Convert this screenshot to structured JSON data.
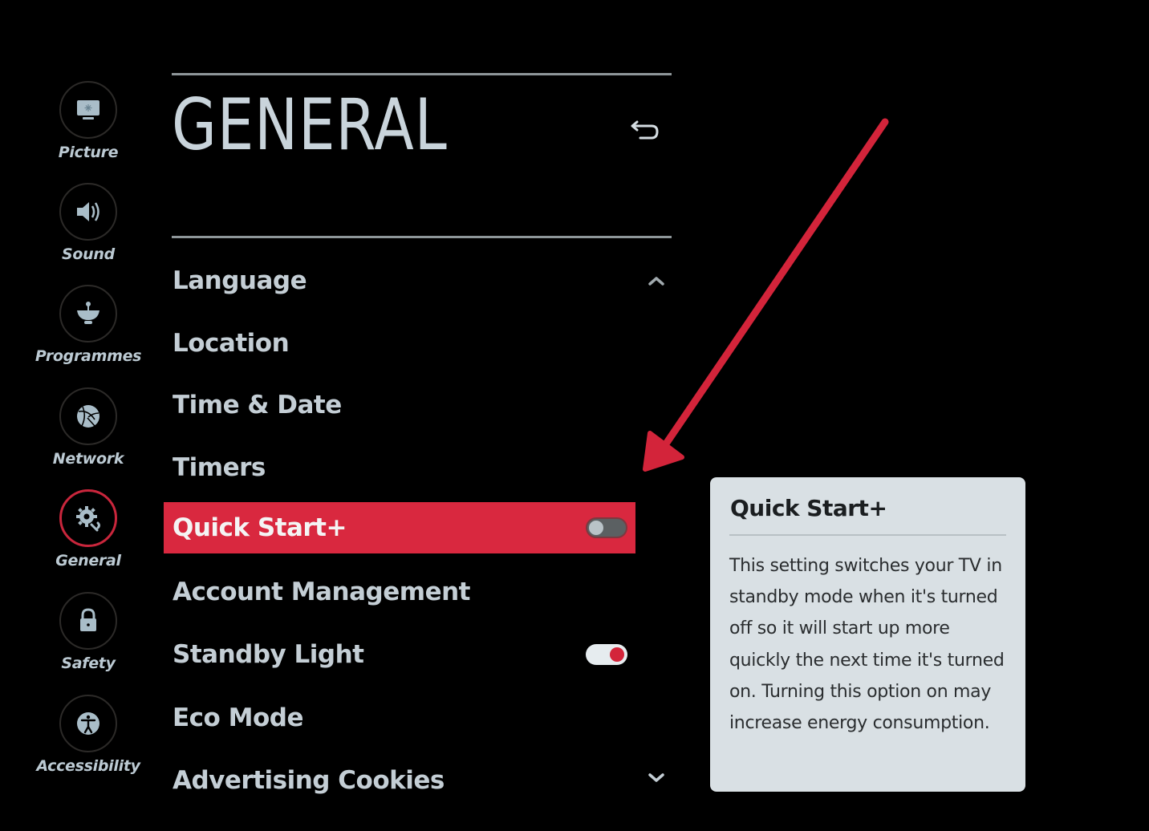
{
  "sidebar": {
    "items": [
      {
        "label": "Picture",
        "icon": "monitor-icon",
        "active": false
      },
      {
        "label": "Sound",
        "icon": "speaker-icon",
        "active": false
      },
      {
        "label": "Programmes",
        "icon": "satellite-dish-icon",
        "active": false
      },
      {
        "label": "Network",
        "icon": "globe-icon",
        "active": false
      },
      {
        "label": "General",
        "icon": "gear-wrench-icon",
        "active": true
      },
      {
        "label": "Safety",
        "icon": "lock-icon",
        "active": false
      },
      {
        "label": "Accessibility",
        "icon": "accessibility-icon",
        "active": false
      }
    ]
  },
  "header": {
    "title": "GENERAL",
    "back_icon": "back-arrow-icon"
  },
  "menu": {
    "items": [
      {
        "label": "Language"
      },
      {
        "label": "Location"
      },
      {
        "label": "Time & Date"
      },
      {
        "label": "Timers"
      },
      {
        "label": "Quick Start+",
        "selected": true,
        "toggle": "off"
      },
      {
        "label": "Account Management"
      },
      {
        "label": "Standby Light",
        "toggle": "on"
      },
      {
        "label": "Eco Mode"
      },
      {
        "label": "Advertising Cookies"
      }
    ],
    "scroll_up_icon": "chevron-up-icon",
    "scroll_down_icon": "chevron-down-icon"
  },
  "info_panel": {
    "title": "Quick Start+",
    "body": "This setting switches your TV in standby mode when it's turned off so it will start up more quickly the next time it's turned on. Turning this option on may increase energy consumption."
  },
  "colors": {
    "accent": "#d9283f",
    "background": "#000000",
    "text": "#c4ced5",
    "panel": "#d9e0e4",
    "annotation": "#d3243a"
  }
}
